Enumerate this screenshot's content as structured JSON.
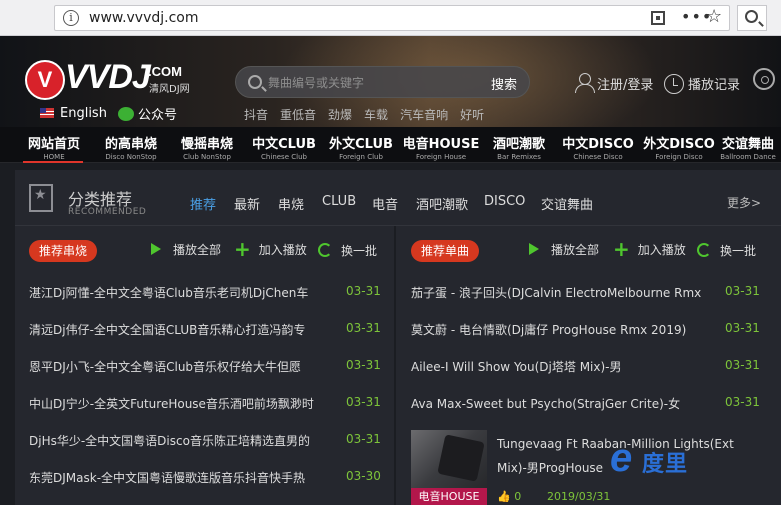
{
  "browser": {
    "url": "www.vvvdj.com"
  },
  "header": {
    "logo_text": "VVDJ",
    "logo_com": ".COM",
    "logo_sub": "清风DJ网",
    "lang_label": "English",
    "wechat_label": "公众号",
    "search_placeholder": "舞曲编号或关键字",
    "search_button": "搜索",
    "hot_words": [
      "抖音",
      "重低音",
      "劲爆",
      "车载",
      "汽车音响",
      "好听"
    ],
    "login_label": "注册/登录",
    "history_label": "播放记录"
  },
  "nav": [
    {
      "cn": "网站首页",
      "en": "HOME"
    },
    {
      "cn": "的高串烧",
      "en": "Disco NonStop"
    },
    {
      "cn": "慢摇串烧",
      "en": "Club NonStop"
    },
    {
      "cn": "中文CLUB",
      "en": "Chinese Club"
    },
    {
      "cn": "外文CLUB",
      "en": "Foreign Club"
    },
    {
      "cn": "电音HOUSE",
      "en": "Foreign House"
    },
    {
      "cn": "酒吧潮歌",
      "en": "Bar Remixes"
    },
    {
      "cn": "中文DISCO",
      "en": "Chinese Disco"
    },
    {
      "cn": "外文DISCO",
      "en": "Foreign Disco"
    },
    {
      "cn": "交谊舞曲",
      "en": "Ballroom Dance"
    }
  ],
  "section": {
    "title": "分类推荐",
    "subtitle": "RECOMMENDED",
    "tabs": [
      "推荐",
      "最新",
      "串烧",
      "CLUB",
      "电音",
      "酒吧潮歌",
      "DISCO",
      "交谊舞曲"
    ],
    "more": "更多>"
  },
  "left_panel": {
    "badge": "推荐串烧",
    "play_all": "播放全部",
    "add_play": "加入播放",
    "refresh": "换一批",
    "rows": [
      {
        "name": "湛江Dj阿懂-全中文全粤语Club音乐老司机DjChen车",
        "date": "03-31"
      },
      {
        "name": "清远Dj伟仔-全中文全国语CLUB音乐精心打造冯韵专",
        "date": "03-31"
      },
      {
        "name": "恩平DJ小飞-全中文全粤语Club音乐权仔给大牛但愿",
        "date": "03-31"
      },
      {
        "name": "中山DJ宁少-全英文FutureHouse音乐酒吧前场飘渺时",
        "date": "03-31"
      },
      {
        "name": "DjHs华少-全中文国粤语Disco音乐陈正培精选直男的",
        "date": "03-31"
      },
      {
        "name": "东莞DJMask-全中文国粤语慢歌连版音乐抖音快手热",
        "date": "03-30"
      }
    ]
  },
  "right_panel": {
    "badge": "推荐单曲",
    "play_all": "播放全部",
    "add_play": "加入播放",
    "refresh": "换一批",
    "rows": [
      {
        "name": "茄子蛋 - 浪子回头(DJCalvin ElectroMelbourne Rmx",
        "date": "03-31"
      },
      {
        "name": "莫文蔚 - 电台情歌(Dj庸仔 ProgHouse Rmx 2019)",
        "date": "03-31"
      },
      {
        "name": "Ailee-I Will Show You(Dj塔塔 Mix)-男",
        "date": "03-31"
      },
      {
        "name": "Ava Max-Sweet but Psycho(StrajGer Crite)-女",
        "date": "03-31"
      }
    ],
    "featured": {
      "label": "电音HOUSE",
      "title": "Tungevaag Ft Raaban-Million Lights(Ext Mix)-男ProgHouse",
      "likes": "0",
      "date": "2019/03/31"
    }
  },
  "watermark": {
    "e": "e",
    "text": "度里"
  }
}
